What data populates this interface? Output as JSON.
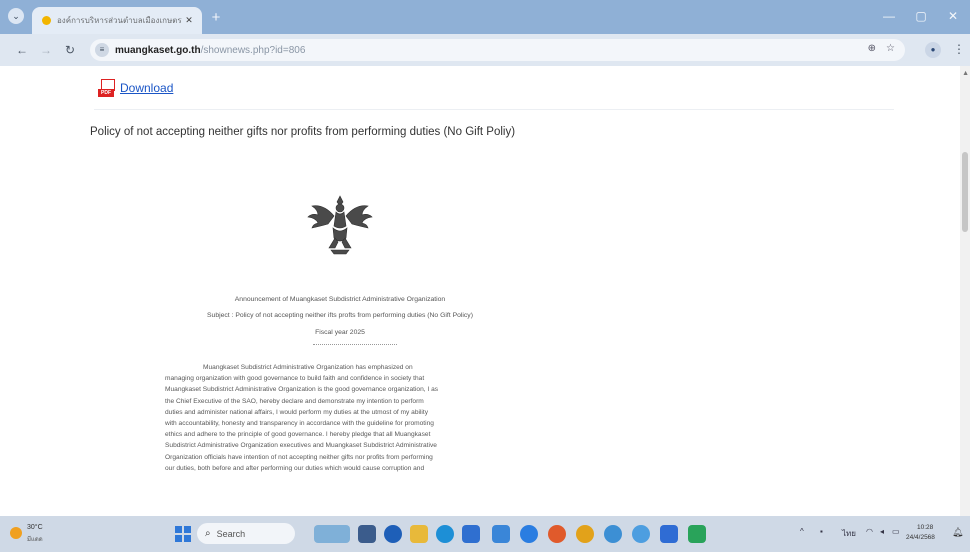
{
  "browser": {
    "tab_title": "องค์การบริหารส่วนตำบลเมืองเกษตร",
    "tab_close": "✕",
    "new_tab": "+",
    "url_host": "muangkaset.go.th",
    "url_path": "/shownews.php?id=806",
    "minimize": "—",
    "maximize": "▢",
    "close": "✕"
  },
  "page": {
    "download_label": "Download",
    "pdf_badge": "PDF",
    "policy_title": "Policy of not accepting neither gifts nor profits from performing duties (No Gift Poliy)"
  },
  "document": {
    "heading": "Announcement of Muangkaset Subdistrict Administrative Organization",
    "subject": "Subject : Policy of not accepting neither ifts profts from performing duties (No Gift Policy)",
    "fiscal_year": "Fiscal year 2025",
    "body_lines": [
      "Muangkaset Subdistrict Administrative Organization has emphasized on",
      "managing organization with good governance to build faith and confidence in society that",
      "Muangkaset Subdistrict Administrative Organization is the good governance organization, I as",
      "the Chief Executive of the SAO, hereby declare and demonstrate my intention to perform",
      "duties and administer national affairs, I would perform my duties at the utmost of my ability",
      "with accountability, honesty and transparency in accordance with the guideline for promoting",
      "ethics and adhere to the principle of good governance. I hereby pledge that all Muangkaset",
      "Subdistrict Administrative Organization executives and Muangkaset Subdistrict Administrative",
      "Organization officials have intention of not accepting neither gifts nor profits from performing",
      "our duties, both before and after performing our duties which would cause corruption and"
    ]
  },
  "taskbar": {
    "temperature": "30°C",
    "condition": "มีแดด",
    "search_placeholder": "Search",
    "time": "10:28",
    "date": "24/4/2568"
  },
  "colors": {
    "tabbar": "#8fb0d6",
    "toolbar": "#dfe7f1",
    "link": "#1a55c6",
    "pdf_red": "#dd2222",
    "taskbar": "#cfd9e6"
  },
  "icons": [
    "chevron-down-icon",
    "close-icon",
    "plus-icon",
    "back-icon",
    "forward-icon",
    "reload-icon",
    "site-info-icon",
    "translate-icon",
    "star-icon",
    "profile-icon",
    "menu-icon",
    "pdf-icon",
    "emblem-icon",
    "weather-icon",
    "windows-icon",
    "search-icon"
  ]
}
